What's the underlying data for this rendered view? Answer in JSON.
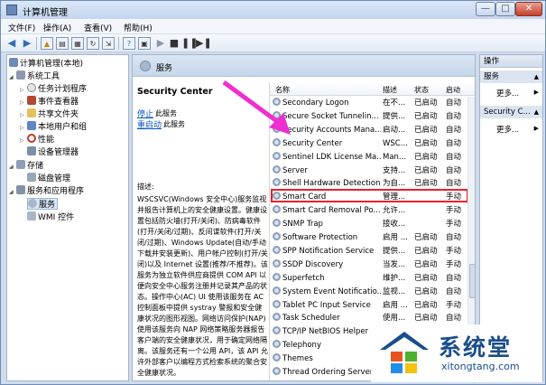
{
  "window": {
    "title": "计算机管理",
    "min": "—",
    "max": "□",
    "close": "✕"
  },
  "menu": [
    "文件(F)",
    "操作(A)",
    "查看(V)",
    "帮助(H)"
  ],
  "tree": [
    {
      "label": "计算机管理(本地)"
    },
    {
      "label": "系统工具"
    },
    {
      "label": "任务计划程序"
    },
    {
      "label": "事件查看器"
    },
    {
      "label": "共享文件夹"
    },
    {
      "label": "本地用户和组"
    },
    {
      "label": "性能"
    },
    {
      "label": "设备管理器"
    },
    {
      "label": "存储"
    },
    {
      "label": "磁盘管理"
    },
    {
      "label": "服务和应用程序"
    },
    {
      "label": "服务"
    },
    {
      "label": "WMI 控件"
    }
  ],
  "center": {
    "header": "服务",
    "service_name": "Security Center",
    "stop_link": "停止",
    "stop_suffix": "此服务",
    "restart_link": "重启动",
    "restart_suffix": "此服务",
    "desc_label": "描述:",
    "description": "WSCSVC(Windows 安全中心)服务监视并报告计算机上的安全健康设置。健康设置包括防火墙(打开/关闭)、防病毒软件(打开/关闭/过期)、反间谍软件(打开/关闭/过期)、Windows Update(自动/手动下载并安装更新)、用户帐户控制(打开/关闭)以及 Internet 设置(推荐/不推荐)。该服务为独立软件供应商提供 COM API 以便向安全中心服务注册并记录其产品的状态。操作中心(AC) UI 使用该服务在 AC 控制面板中提供 systray 警报和安全健康状况的图形视图。网络访问保护(NAP)使用该服务向 NAP 网络策略服务器报告客户端的安全健康状况，用于确定网络隔离。该服务还有一个公用 API，该 API 允许外部客户以编程方式检索系统的聚合安全健康状况。"
  },
  "columns": {
    "name": "名称",
    "desc": "描述",
    "status": "状态",
    "startup": "启动"
  },
  "services": [
    {
      "name": "Secondary Logon",
      "desc": "在不...",
      "status": "已启动",
      "startup": "自动"
    },
    {
      "name": "Secure Socket Tunnelin...",
      "desc": "提供...",
      "status": "已启动",
      "startup": "自动"
    },
    {
      "name": "Security Accounts Mana...",
      "desc": "启动...",
      "status": "已启动",
      "startup": "自动"
    },
    {
      "name": "Security Center",
      "desc": "WSC...",
      "status": "已启动",
      "startup": "自动"
    },
    {
      "name": "Sentinel LDK License Ma...",
      "desc": "Man...",
      "status": "已启动",
      "startup": "自动"
    },
    {
      "name": "Server",
      "desc": "支持...",
      "status": "已启动",
      "startup": "自动"
    },
    {
      "name": "Shell Hardware Detection",
      "desc": "为自...",
      "status": "已启动",
      "startup": "自动"
    },
    {
      "name": "Smart Card",
      "desc": "管理...",
      "status": "",
      "startup": "手动"
    },
    {
      "name": "Smart Card Removal Po...",
      "desc": "允许...",
      "status": "",
      "startup": "手动"
    },
    {
      "name": "SNMP Trap",
      "desc": "接收...",
      "status": "",
      "startup": "手动"
    },
    {
      "name": "Software Protection",
      "desc": "启用 ...",
      "status": "已启动",
      "startup": "自动"
    },
    {
      "name": "SPP Notification Service",
      "desc": "提供...",
      "status": "已启动",
      "startup": "手动"
    },
    {
      "name": "SSDP Discovery",
      "desc": "当发...",
      "status": "已启动",
      "startup": "手动"
    },
    {
      "name": "Superfetch",
      "desc": "维护...",
      "status": "已启动",
      "startup": "自动"
    },
    {
      "name": "System Event Notificatio...",
      "desc": "监视...",
      "status": "已启动",
      "startup": "自动"
    },
    {
      "name": "Tablet PC Input Service",
      "desc": "启用 ...",
      "status": "已启动",
      "startup": "手动"
    },
    {
      "name": "Task Scheduler",
      "desc": "使用...",
      "status": "已启动",
      "startup": "自动"
    },
    {
      "name": "TCP/IP NetBIOS Helper",
      "desc": "",
      "status": "",
      "startup": ""
    },
    {
      "name": "Telephony",
      "desc": "",
      "status": "",
      "startup": ""
    },
    {
      "name": "Themes",
      "desc": "",
      "status": "",
      "startup": ""
    },
    {
      "name": "Thread Ordering Server",
      "desc": "",
      "status": "",
      "startup": ""
    }
  ],
  "actions": {
    "header": "操作",
    "section1": "服务",
    "more1": "更多...",
    "section2": "Security C...",
    "more2": "更多..."
  },
  "watermark": {
    "brand": "系统堂",
    "url": "xitongtang.com"
  },
  "colors": {
    "highlight_border": "#e8212b",
    "arrow": "#ee2fd0",
    "link": "#0b56c4"
  }
}
